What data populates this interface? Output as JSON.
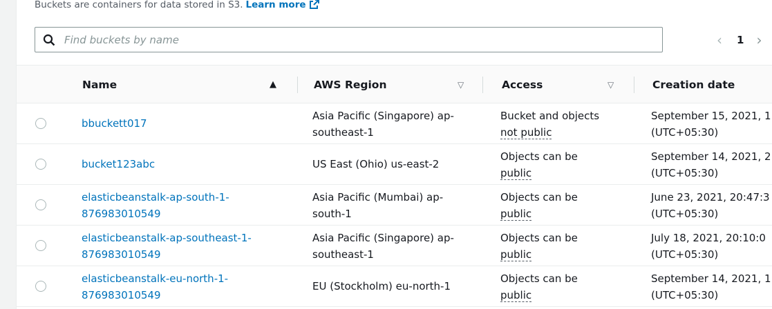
{
  "header": {
    "description": "Buckets are containers for data stored in S3.",
    "learn_more": "Learn more"
  },
  "search": {
    "placeholder": "Find buckets by name",
    "value": ""
  },
  "pagination": {
    "prev": "‹",
    "current_page": "1",
    "next": "›"
  },
  "table": {
    "columns": [
      "Name",
      "AWS Region",
      "Access",
      "Creation date"
    ],
    "rows": [
      {
        "name": [
          "bbuckett017"
        ],
        "region": [
          "Asia Pacific (Singapore) ap-",
          "southeast-1"
        ],
        "access": [
          "Bucket and objects",
          "not public"
        ],
        "created": [
          "September 15, 2021, 1",
          "(UTC+05:30)"
        ]
      },
      {
        "name": [
          "bucket123abc"
        ],
        "region": [
          "US East (Ohio) us-east-2"
        ],
        "access": [
          "Objects can be",
          "public"
        ],
        "created": [
          "September 14, 2021, 2",
          "(UTC+05:30)"
        ]
      },
      {
        "name": [
          "elasticbeanstalk-ap-south-1-",
          "876983010549"
        ],
        "region": [
          "Asia Pacific (Mumbai) ap-",
          "south-1"
        ],
        "access": [
          "Objects can be",
          "public"
        ],
        "created": [
          "June 23, 2021, 20:47:3",
          "(UTC+05:30)"
        ]
      },
      {
        "name": [
          "elasticbeanstalk-ap-southeast-1-",
          "876983010549"
        ],
        "region": [
          "Asia Pacific (Singapore) ap-",
          "southeast-1"
        ],
        "access": [
          "Objects can be",
          "public"
        ],
        "created": [
          "July 18, 2021, 20:10:0",
          "(UTC+05:30)"
        ]
      },
      {
        "name": [
          "elasticbeanstalk-eu-north-1-",
          "876983010549"
        ],
        "region": [
          "EU (Stockholm) eu-north-1"
        ],
        "access": [
          "Objects can be",
          "public"
        ],
        "created": [
          "September 14, 2021, 1",
          "(UTC+05:30)"
        ]
      }
    ]
  },
  "colors": {
    "link": "#0073bb",
    "text": "#16191f",
    "muted": "#545b64"
  },
  "icons": {
    "search": "search-icon",
    "external": "external-link-icon",
    "sort_asc": "sort-ascending-icon",
    "sort": "sort-icon"
  }
}
